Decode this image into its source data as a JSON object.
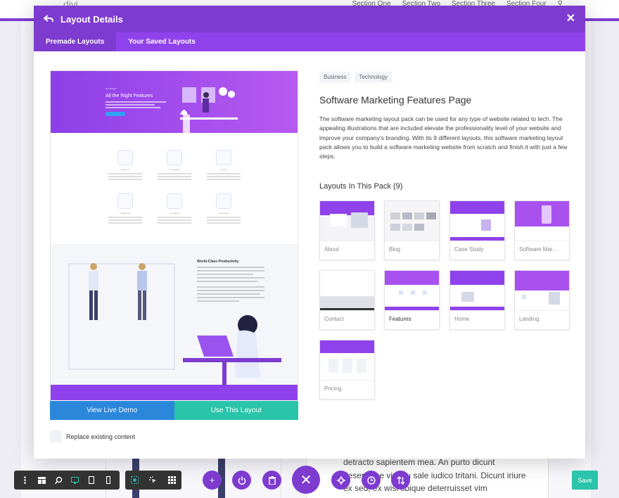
{
  "background": {
    "logo": "divi",
    "nav": [
      "Section One",
      "Section Two",
      "Section Three",
      "Section Four"
    ],
    "body_lines": [
      "detracto sapientem mea. An purto dicunt",
      "deseruisse vix, eu sale iudico tritani. Dicunt iriure",
      "ex sed, ex wisi tibique deterruisset vim"
    ]
  },
  "modal": {
    "title": "Layout Details",
    "tabs": [
      "Premade Layouts",
      "Your Saved Layouts"
    ],
    "active_tab": 0
  },
  "preview": {
    "hero_small": "Get Started",
    "hero_title": "All the Right Features",
    "features": [
      "WORKFLOW",
      "CUSTOMIZABLE",
      "SECURITY",
      "INTEGRATIONS",
      "DOCUMENTS",
      "PRICE MODEL"
    ],
    "productivity_title": "World-Class Productivity",
    "live_demo_label": "View Live Demo",
    "use_layout_label": "Use This Layout",
    "replace_label": "Replace existing content",
    "replace_checked": false
  },
  "details": {
    "tags": [
      "Business",
      "Technology"
    ],
    "name": "Software Marketing Features Page",
    "description": "The software marketing layout pack can be used for any type of website related to tech. The appealing illustrations that are included elevate the professionality level of your website and improve your company's branding. With its 9 different layouts, this software marketing layout pack allows you to build a software marketing website from scratch and finish it with just a few steps.",
    "pack_title": "Layouts In This Pack (9)",
    "layouts": [
      "About",
      "Blog",
      "Case Study",
      "Software Mar...",
      "Contact",
      "Features",
      "Home",
      "Landing",
      "Pricing"
    ],
    "active_layout": "Features"
  },
  "toolbar": {
    "save_label": "Save"
  },
  "colors": {
    "primary": "#7e3bd0",
    "tab_bar": "#8f42ec",
    "blue": "#2b87da",
    "teal": "#29c4a9"
  }
}
